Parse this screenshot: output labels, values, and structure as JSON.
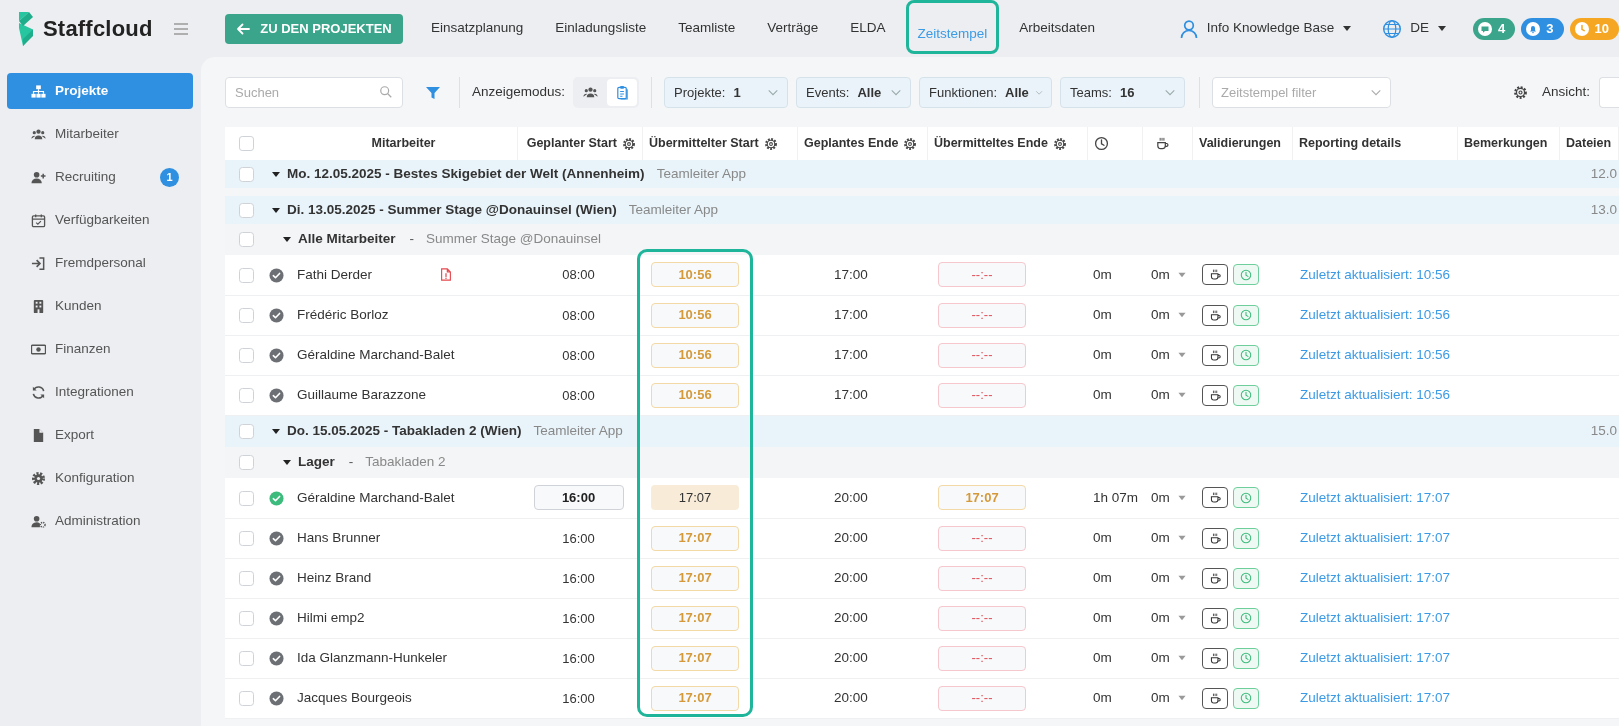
{
  "app": {
    "brand": "Staffcloud"
  },
  "sidebar": {
    "items": [
      {
        "label": "Projekte",
        "selected": true
      },
      {
        "label": "Mitarbeiter",
        "selected": false
      },
      {
        "label": "Recruiting",
        "selected": false,
        "badge": "1"
      },
      {
        "label": "Verfügbarkeiten",
        "selected": false
      },
      {
        "label": "Fremdpersonal",
        "selected": false
      },
      {
        "label": "Kunden",
        "selected": false
      },
      {
        "label": "Finanzen",
        "selected": false
      },
      {
        "label": "Integrationen",
        "selected": false
      },
      {
        "label": "Export",
        "selected": false
      },
      {
        "label": "Konfiguration",
        "selected": false
      },
      {
        "label": "Administration",
        "selected": false
      }
    ]
  },
  "topbar": {
    "back_button": "ZU DEN PROJEKTEN",
    "tabs": [
      {
        "label": "Einsatzplanung",
        "selected": false
      },
      {
        "label": "Einladungsliste",
        "selected": false
      },
      {
        "label": "Teamliste",
        "selected": false
      },
      {
        "label": "Verträge",
        "selected": false
      },
      {
        "label": "ELDA",
        "selected": false
      },
      {
        "label": "Zeitstempel",
        "selected": true,
        "highlighted": true
      },
      {
        "label": "Arbeitsdaten",
        "selected": false
      }
    ],
    "user": "Info Knowledge Base",
    "language": "DE",
    "counters": [
      {
        "kind": "messages",
        "count": "4",
        "color": "#3aa58a"
      },
      {
        "kind": "notifications",
        "count": "3",
        "color": "#2f8fe0"
      },
      {
        "kind": "timer",
        "count": "10",
        "color": "#f5a623"
      }
    ]
  },
  "toolbar": {
    "search": {
      "placeholder": "Suchen"
    },
    "display_mode": {
      "label": "Anzeigemodus:",
      "options": [
        {
          "kind": "people",
          "selected": false
        },
        {
          "kind": "clipboard",
          "selected": true
        }
      ]
    },
    "filters": [
      {
        "label": "Projekte:",
        "value": "1"
      },
      {
        "label": "Events:",
        "value": "Alle"
      },
      {
        "label": "Funktionen:",
        "value": "Alle"
      },
      {
        "label": "Teams:",
        "value": "16"
      }
    ],
    "timestamp_filter": {
      "placeholder": "Zeitstempel filter"
    },
    "view": {
      "label": "Ansicht:"
    }
  },
  "table": {
    "select_all_checked": false,
    "columns": [
      {
        "kind": "text",
        "label": "Mitarbeiter",
        "settings": false
      },
      {
        "kind": "text",
        "label": "Geplanter Start",
        "settings": true
      },
      {
        "kind": "text",
        "label": "Übermittelter Start",
        "settings": true,
        "highlighted": true
      },
      {
        "kind": "text",
        "label": "Geplantes Ende",
        "settings": true
      },
      {
        "kind": "text",
        "label": "Übermitteltes Ende",
        "settings": true
      },
      {
        "kind": "clock",
        "settings": false
      },
      {
        "kind": "coffee",
        "settings": false
      },
      {
        "kind": "text",
        "label": "Validierungen",
        "settings": false
      },
      {
        "kind": "text",
        "label": "Reporting details",
        "settings": false
      },
      {
        "kind": "text",
        "label": "Bemerkungen",
        "settings": false
      },
      {
        "kind": "text",
        "label": "Dateien"
      }
    ],
    "groups": [
      {
        "checked": false,
        "expanded": true,
        "title": "Mo. 12.05.2025 - Bestes Skigebiet der Welt (Annenheim)",
        "source": "Teamleiter App",
        "date": "12.0"
      },
      {
        "checked": false,
        "expanded": true,
        "title": "Di. 13.05.2025 - Summer Stage @Donauinsel (Wien)",
        "source": "Teamleiter App",
        "date": "13.0",
        "teams": [
          {
            "checked": false,
            "expanded": true,
            "title": "Alle Mitarbeiter",
            "separator": "-",
            "location": "Summer Stage @Donauinsel",
            "rows": [
              {
                "checked": false,
                "validated": false,
                "name": "Fathi Derder",
                "document": true,
                "planned_start": "08:00",
                "planned_start_edited": false,
                "submitted_start": "10:56",
                "submitted_start_confirmed": false,
                "planned_end": "17:00",
                "submitted_end": "--:--",
                "submitted_end_missing": true,
                "worked": "0m",
                "break": "0m",
                "reporting": "Zuletzt aktualisiert: 10:56"
              },
              {
                "checked": false,
                "validated": false,
                "name": "Frédéric Borloz",
                "document": false,
                "planned_start": "08:00",
                "planned_start_edited": false,
                "submitted_start": "10:56",
                "submitted_start_confirmed": false,
                "planned_end": "17:00",
                "submitted_end": "--:--",
                "submitted_end_missing": true,
                "worked": "0m",
                "break": "0m",
                "reporting": "Zuletzt aktualisiert: 10:56"
              },
              {
                "checked": false,
                "validated": false,
                "name": "Géraldine Marchand-Balet",
                "document": false,
                "planned_start": "08:00",
                "planned_start_edited": false,
                "submitted_start": "10:56",
                "submitted_start_confirmed": false,
                "planned_end": "17:00",
                "submitted_end": "--:--",
                "submitted_end_missing": true,
                "worked": "0m",
                "break": "0m",
                "reporting": "Zuletzt aktualisiert: 10:56"
              },
              {
                "checked": false,
                "validated": false,
                "name": "Guillaume Barazzone",
                "document": false,
                "planned_start": "08:00",
                "planned_start_edited": false,
                "submitted_start": "10:56",
                "submitted_start_confirmed": false,
                "planned_end": "17:00",
                "submitted_end": "--:--",
                "submitted_end_missing": true,
                "worked": "0m",
                "break": "0m",
                "reporting": "Zuletzt aktualisiert: 10:56"
              }
            ]
          }
        ]
      },
      {
        "checked": false,
        "expanded": true,
        "title": "Do. 15.05.2025 - Tabakladen 2 (Wien)",
        "source": "Teamleiter App",
        "date": "15.0",
        "teams": [
          {
            "checked": false,
            "expanded": true,
            "title": "Lager",
            "separator": "-",
            "location": "Tabakladen 2",
            "rows": [
              {
                "checked": false,
                "validated": true,
                "name": "Géraldine Marchand-Balet",
                "document": false,
                "planned_start": "16:00",
                "planned_start_edited": true,
                "submitted_start": "17:07",
                "submitted_start_confirmed": true,
                "planned_end": "20:00",
                "submitted_end": "17:07",
                "submitted_end_missing": false,
                "worked": "1h 07m",
                "break": "0m",
                "reporting": "Zuletzt aktualisiert: 17:07"
              },
              {
                "checked": false,
                "validated": false,
                "name": "Hans Brunner",
                "document": false,
                "planned_start": "16:00",
                "planned_start_edited": false,
                "submitted_start": "17:07",
                "submitted_start_confirmed": false,
                "planned_end": "20:00",
                "submitted_end": "--:--",
                "submitted_end_missing": true,
                "worked": "0m",
                "break": "0m",
                "reporting": "Zuletzt aktualisiert: 17:07"
              },
              {
                "checked": false,
                "validated": false,
                "name": "Heinz Brand",
                "document": false,
                "planned_start": "16:00",
                "planned_start_edited": false,
                "submitted_start": "17:07",
                "submitted_start_confirmed": false,
                "planned_end": "20:00",
                "submitted_end": "--:--",
                "submitted_end_missing": true,
                "worked": "0m",
                "break": "0m",
                "reporting": "Zuletzt aktualisiert: 17:07"
              },
              {
                "checked": false,
                "validated": false,
                "name": "Hilmi emp2",
                "document": false,
                "planned_start": "16:00",
                "planned_start_edited": false,
                "submitted_start": "17:07",
                "submitted_start_confirmed": false,
                "planned_end": "20:00",
                "submitted_end": "--:--",
                "submitted_end_missing": true,
                "worked": "0m",
                "break": "0m",
                "reporting": "Zuletzt aktualisiert: 17:07"
              },
              {
                "checked": false,
                "validated": false,
                "name": "Ida Glanzmann-Hunkeler",
                "document": false,
                "planned_start": "16:00",
                "planned_start_edited": false,
                "submitted_start": "17:07",
                "submitted_start_confirmed": false,
                "planned_end": "20:00",
                "submitted_end": "--:--",
                "submitted_end_missing": true,
                "worked": "0m",
                "break": "0m",
                "reporting": "Zuletzt aktualisiert: 17:07"
              },
              {
                "checked": false,
                "validated": false,
                "name": "Jacques Bourgeois",
                "document": false,
                "planned_start": "16:00",
                "planned_start_edited": false,
                "submitted_start": "17:07",
                "submitted_start_confirmed": false,
                "planned_end": "20:00",
                "submitted_end": "--:--",
                "submitted_end_missing": true,
                "worked": "0m",
                "break": "0m",
                "reporting": "Zuletzt aktualisiert: 17:07"
              }
            ]
          }
        ]
      }
    ]
  }
}
